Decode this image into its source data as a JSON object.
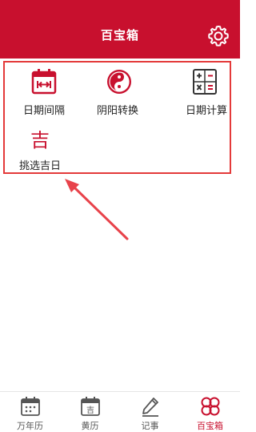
{
  "header": {
    "title": "百宝箱",
    "settings_icon": "gear-icon"
  },
  "tools": [
    {
      "label": "日期间隔",
      "icon": "date-interval-calendar-icon"
    },
    {
      "label": "阴阳转换",
      "icon": "yin-yang-icon"
    },
    {
      "label": "日期计算",
      "icon": "calculator-icon"
    },
    {
      "label": "挑选吉日",
      "icon": "auspicious-day-icon",
      "glyph": "吉"
    }
  ],
  "bottom_nav": [
    {
      "label": "万年历",
      "icon": "calendar-icon",
      "active": false
    },
    {
      "label": "黄历",
      "icon": "almanac-icon",
      "glyph": "吉",
      "active": false
    },
    {
      "label": "记事",
      "icon": "pencil-icon",
      "active": false
    },
    {
      "label": "百宝箱",
      "icon": "clover-icon",
      "active": true
    }
  ],
  "colors": {
    "brand_red": "#c8102e",
    "highlight_border": "#e43a3a",
    "arrow": "#e8424a",
    "inactive_nav": "#555555"
  }
}
